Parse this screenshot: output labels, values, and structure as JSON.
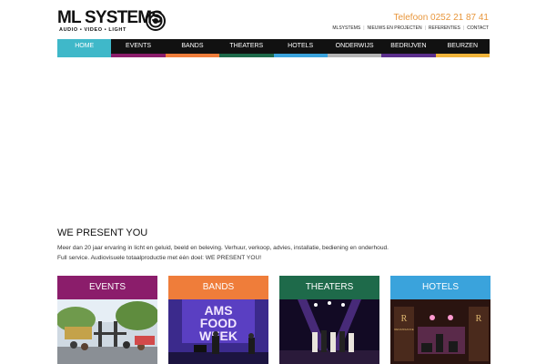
{
  "brand": {
    "name": "ML SYSTEMS",
    "tagline": "AUDIO • VIDEO • LIGHT"
  },
  "header": {
    "phone": "Telefoon 0252 21 87 41",
    "links": [
      "MLSYSTEMS",
      "NIEUWS EN PROJECTEN",
      "REFERENTIES",
      "CONTACT"
    ]
  },
  "nav": {
    "items": [
      {
        "label": "HOME",
        "color": "#3fb8c9",
        "active": true
      },
      {
        "label": "EVENTS",
        "color": "#8b1d6b"
      },
      {
        "label": "BANDS",
        "color": "#ef7d3a"
      },
      {
        "label": "THEATERS",
        "color": "#1e6a4a"
      },
      {
        "label": "HOTELS",
        "color": "#3aa3dc"
      },
      {
        "label": "ONDERWIJS",
        "color": "#b3b3b3"
      },
      {
        "label": "BEDRIJVEN",
        "color": "#5b2f8c"
      },
      {
        "label": "BEURZEN",
        "color": "#f0b43a"
      }
    ]
  },
  "intro": {
    "title": "WE PRESENT YOU",
    "line1": "Meer dan 20 jaar ervaring in licht en geluid, beeld en beleving. Verhuur, verkoop, advies, installatie, bediening en onderhoud.",
    "line2": "Full service. Audiovisuele totaalproductie met één doel: WE PRESENT YOU!"
  },
  "cards": [
    {
      "label": "EVENTS",
      "color": "#8b1d6b",
      "icon": "events-photo"
    },
    {
      "label": "BANDS",
      "color": "#ef7d3a",
      "icon": "bands-photo",
      "sign_text": "AMS FOOD WEEK"
    },
    {
      "label": "THEATERS",
      "color": "#1e6a4a",
      "icon": "theaters-photo"
    },
    {
      "label": "HOTELS",
      "color": "#3aa3dc",
      "icon": "hotels-photo",
      "sign_text": "RENAISSANCE"
    }
  ]
}
